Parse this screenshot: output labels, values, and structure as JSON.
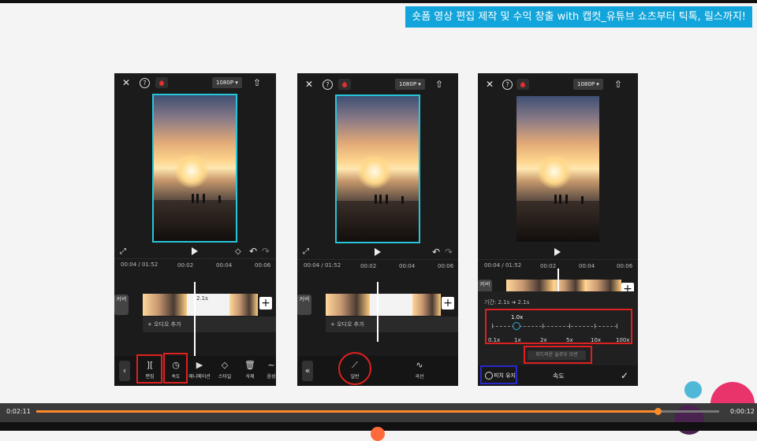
{
  "title_banner": "숏폼 영상 편집 제작 및 수익 창출 with 캡컷_유튜브 쇼츠부터 틱톡, 릴스까지!",
  "colors": {
    "accent_banner": "#12a5db",
    "highlight_red": "#e02020",
    "highlight_blue": "#2828c8",
    "progress": "#ff8a2a"
  },
  "icons": {
    "close": "✕",
    "help": "?",
    "export": "⇧",
    "expand": "⤢",
    "play": "play-triangle",
    "undo": "↶",
    "redo": "↷",
    "back": "‹",
    "double_back": "«",
    "check": "✓",
    "add": "+"
  },
  "phone1": {
    "resolution": "1080P ▾",
    "timecode": "00:04 / 01:52",
    "time_markers": [
      "00:02",
      "00:04",
      "00:06"
    ],
    "cover_label": "커버",
    "clip_badge": "2.1s",
    "add_audio": "+ 오디오 추가",
    "tools": [
      {
        "icon": "][",
        "label": "편집"
      },
      {
        "icon": "◷",
        "label": "속도"
      },
      {
        "icon": "▶",
        "label": "애니메이션"
      },
      {
        "icon": "◇",
        "label": "스타일"
      },
      {
        "icon": "🗑",
        "label": "삭제"
      },
      {
        "icon": "~",
        "label": "음성"
      }
    ]
  },
  "phone2": {
    "resolution": "1080P ▾",
    "timecode": "00:04 / 01:52",
    "time_markers": [
      "00:02",
      "00:04",
      "00:06"
    ],
    "cover_label": "커버",
    "add_audio": "+ 오디오 추가",
    "tools": [
      {
        "icon": "⟋",
        "label": "일반"
      },
      {
        "icon": "∿",
        "label": "곡선"
      }
    ]
  },
  "phone3": {
    "resolution": "1080P ▾",
    "timecode": "00:04 / 01:52",
    "time_markers": [
      "00:02",
      "00:04",
      "00:06"
    ],
    "cover_label": "커버",
    "duration": "기간: 2.1s  ➜  2.1s",
    "current_speed": "1.0x",
    "speed_value": 1.0,
    "speed_scale": [
      "0.1x",
      "1x",
      "2x",
      "5x",
      "10x",
      "100x"
    ],
    "smooth_button": "부드러운 슬로우 모션",
    "pitch_label": "피치 유지",
    "panel_title": "속도"
  },
  "player": {
    "current_time": "0:02:11",
    "total_time": "0:00:12",
    "progress": 0.91
  }
}
